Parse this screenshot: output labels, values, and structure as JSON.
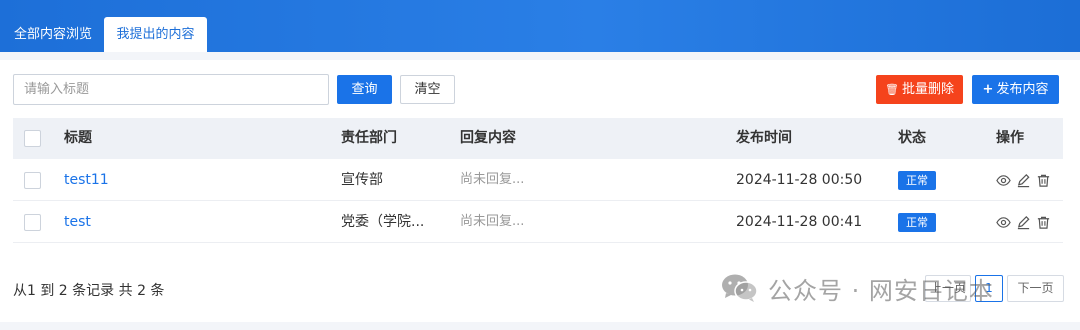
{
  "tabs": {
    "browse_all": "全部内容浏览",
    "my_submissions": "我提出的内容"
  },
  "toolbar": {
    "search_placeholder": "请输入标题",
    "query_label": "查询",
    "clear_label": "清空",
    "batch_delete_icon": "trash-icon",
    "batch_delete_label": "批量删除",
    "publish_icon": "plus-icon",
    "publish_label": "发布内容"
  },
  "table": {
    "headers": {
      "title": "标题",
      "department": "责任部门",
      "reply": "回复内容",
      "publish_time": "发布时间",
      "status": "状态",
      "actions": "操作"
    },
    "rows": [
      {
        "title": "test11",
        "department": "宣传部",
        "reply": "尚未回复...",
        "publish_time": "2024-11-28 00:50",
        "status": "正常"
      },
      {
        "title": "test",
        "department": "党委（学院...",
        "reply": "尚未回复...",
        "publish_time": "2024-11-28 00:41",
        "status": "正常"
      }
    ],
    "row_actions": [
      "eye-icon",
      "edit-icon",
      "trash-icon"
    ]
  },
  "footer": {
    "summary": "从1 到 2 条记录 共 2 条",
    "pager": {
      "prev": "上一页",
      "current": "1",
      "next": "下一页"
    }
  },
  "watermark": {
    "icon": "wechat-icon",
    "text": "公众号 · 网安日记本"
  },
  "colors": {
    "header_blue": "#1d6fd8",
    "primary": "#1a73e8",
    "danger": "#f5431c",
    "table_header_bg": "#eef1f6"
  }
}
